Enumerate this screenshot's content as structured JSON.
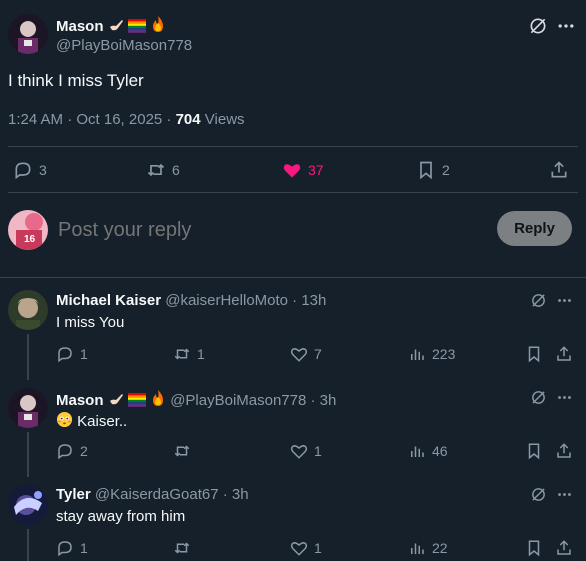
{
  "main_post": {
    "author_name": "Mason",
    "author_handle": "@PlayBoiMason778",
    "text": "I think I miss Tyler",
    "time": "1:24 AM · Oct 16, 2025 · ",
    "views_count": "704",
    "views_label": " Views",
    "replies": "3",
    "reposts": "6",
    "likes": "37",
    "bookmarks": "2",
    "like_color": "#f91880"
  },
  "compose": {
    "placeholder": "Post your reply",
    "reply_button": "Reply",
    "avatar_badge": "16"
  },
  "replies": [
    {
      "name": "Michael Kaiser",
      "handle": "@kaiserHelloMoto · 13h",
      "text": "I miss You",
      "replies": "1",
      "reposts": "1",
      "likes": "7",
      "views": "223"
    },
    {
      "name": "Mason",
      "handle": "@PlayBoiMason778 · 3h",
      "text": "Kaiser..",
      "replies": "2",
      "reposts": "",
      "likes": "1",
      "views": "46"
    },
    {
      "name": "Tyler",
      "handle": "@KaiserdaGoat67 · 3h",
      "text": "stay away from him",
      "replies": "1",
      "reposts": "",
      "likes": "1",
      "views": "22"
    }
  ],
  "icons": [
    "grok-icon",
    "more-icon",
    "reply-icon",
    "repost-icon",
    "like-icon",
    "bookmark-icon",
    "share-icon",
    "views-icon"
  ]
}
